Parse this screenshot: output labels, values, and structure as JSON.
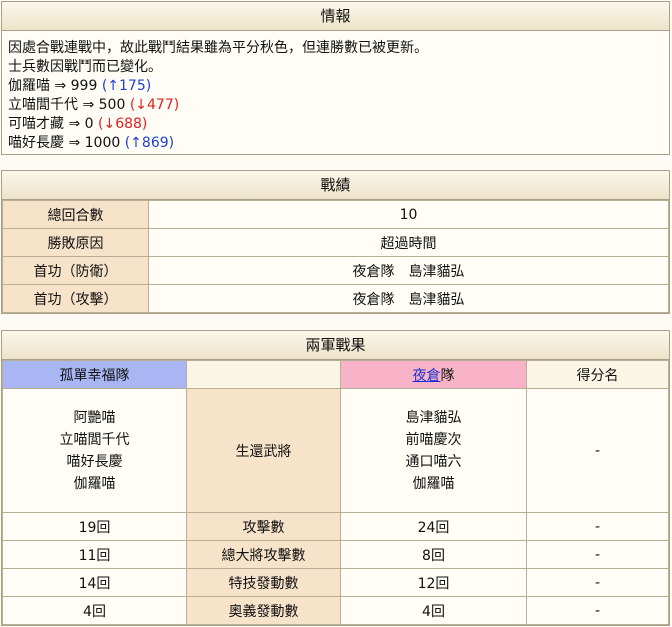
{
  "info": {
    "title": "情報",
    "line1": "因處合戰連戰中，故此戰鬥結果雖為平分秋色，但連勝數已被更新。",
    "line2": "士兵數因戰鬥而已變化。",
    "rows": [
      {
        "name": "伽羅喵 ⇒ 999",
        "delta": "(↑175)",
        "dir": "up"
      },
      {
        "name": "立喵閭千代 ⇒ 500",
        "delta": "(↓477)",
        "dir": "down"
      },
      {
        "name": "可喵才藏 ⇒ 0",
        "delta": "(↓688)",
        "dir": "down"
      },
      {
        "name": "喵好長慶 ⇒ 1000",
        "delta": "(↑869)",
        "dir": "up"
      }
    ]
  },
  "record": {
    "title": "戰績",
    "rows": [
      {
        "label": "總回合數",
        "value": "10"
      },
      {
        "label": "勝敗原因",
        "value": "超過時間"
      },
      {
        "label": "首功（防衛）",
        "value": "夜倉隊　島津貓弘"
      },
      {
        "label": "首功（攻擊）",
        "value": "夜倉隊　島津貓弘"
      }
    ]
  },
  "results": {
    "title": "兩軍戰果",
    "left_team": "孤單幸福隊",
    "right_team_link": "夜倉",
    "right_team_suffix": "隊",
    "score_header": "得分名",
    "survivor_label": "生還武將",
    "left_survivors": [
      "阿艷喵",
      "立喵閭千代",
      "喵好長慶",
      "伽羅喵"
    ],
    "right_survivors": [
      "島津貓弘",
      "前喵慶次",
      "通口喵六",
      "伽羅喵"
    ],
    "survivor_score": "-",
    "stats": [
      {
        "left": "19回",
        "label": "攻擊數",
        "right": "24回",
        "score": "-"
      },
      {
        "left": "11回",
        "label": "總大將攻擊數",
        "right": "8回",
        "score": "-"
      },
      {
        "left": "14回",
        "label": "特技發動數",
        "right": "12回",
        "score": "-"
      },
      {
        "left": "4回",
        "label": "奧義發動數",
        "right": "4回",
        "score": "-"
      }
    ]
  }
}
